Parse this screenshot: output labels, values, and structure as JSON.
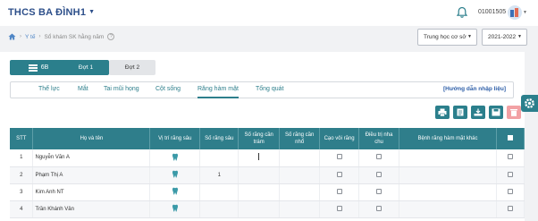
{
  "header": {
    "school": "THCS BA ĐÌNH1",
    "user_id": "01001505"
  },
  "breadcrumb": {
    "level1": "Y tế",
    "level2": "Sổ khám SK hằng năm"
  },
  "filters": {
    "level": "Trung học cơ sở",
    "year": "2021-2022"
  },
  "class_button": "6B",
  "periods": [
    "Đợt 1",
    "Đợt 2"
  ],
  "tabs": [
    "Thể lực",
    "Mắt",
    "Tai mũi họng",
    "Cột sống",
    "Răng hàm mặt",
    "Tổng quát"
  ],
  "active_tab": "Răng hàm mặt",
  "guide_link": "[Hướng dẫn nhập liệu]",
  "colors": {
    "primary": "#2b7f8c",
    "delete": "#f2a1a4",
    "title": "#2d4f8a"
  },
  "table": {
    "headers": [
      "STT",
      "Họ và tên",
      "Vị trí răng sâu",
      "Số răng sâu",
      "Số răng cần trám",
      "Số răng cần nhổ",
      "Cạo vôi răng",
      "Điều trị nha chu",
      "Bệnh răng hàm mặt khác"
    ],
    "rows": [
      {
        "stt": "1",
        "name": "Nguyễn Văn A",
        "so_rang_sau": ""
      },
      {
        "stt": "2",
        "name": "Phạm Thị A",
        "so_rang_sau": "1"
      },
      {
        "stt": "3",
        "name": "Kim Anh NT",
        "so_rang_sau": ""
      },
      {
        "stt": "4",
        "name": "Trần Khánh Vân",
        "so_rang_sau": ""
      }
    ]
  }
}
